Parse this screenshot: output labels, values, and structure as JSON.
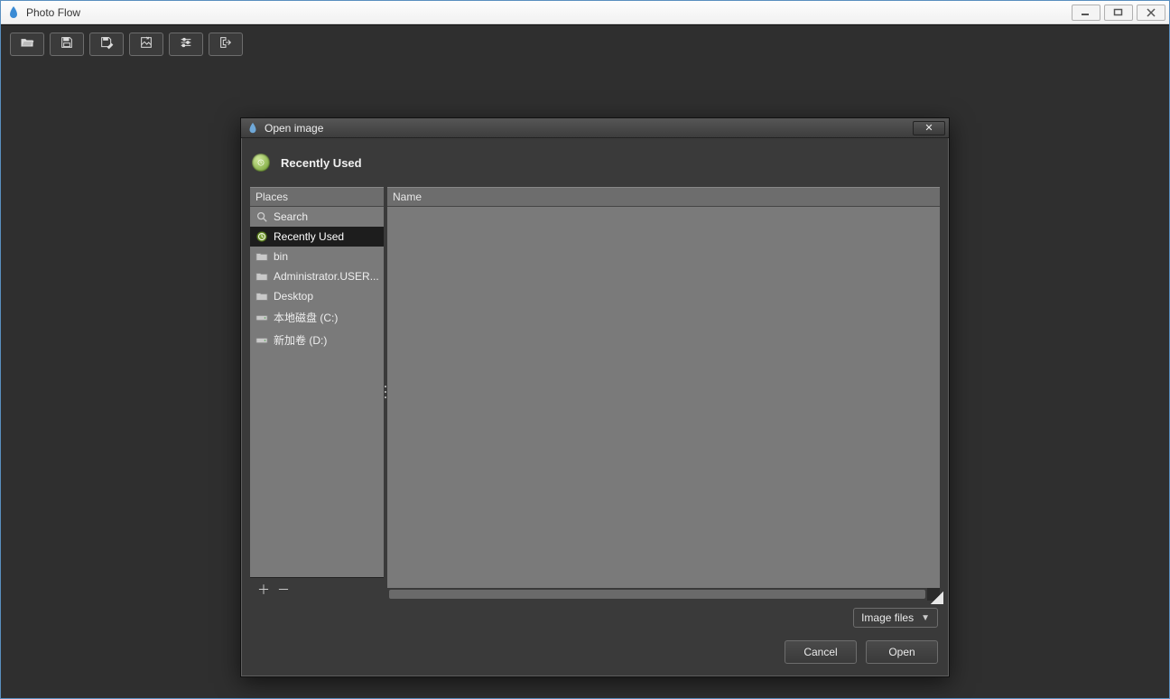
{
  "app": {
    "title": "Photo Flow"
  },
  "dialog": {
    "title": "Open image",
    "path_label": "Recently Used",
    "places_header": "Places",
    "file_header": "Name",
    "places": [
      {
        "icon": "search",
        "label": "Search"
      },
      {
        "icon": "recent",
        "label": "Recently Used",
        "selected": true
      },
      {
        "icon": "folder",
        "label": "bin"
      },
      {
        "icon": "folder",
        "label": "Administrator.USER..."
      },
      {
        "icon": "folder",
        "label": "Desktop"
      },
      {
        "icon": "drive",
        "label": "本地磁盘 (C:)"
      },
      {
        "icon": "drive",
        "label": "新加卷 (D:)"
      }
    ],
    "filter": {
      "label": "Image files"
    },
    "buttons": {
      "cancel": "Cancel",
      "open": "Open"
    }
  }
}
